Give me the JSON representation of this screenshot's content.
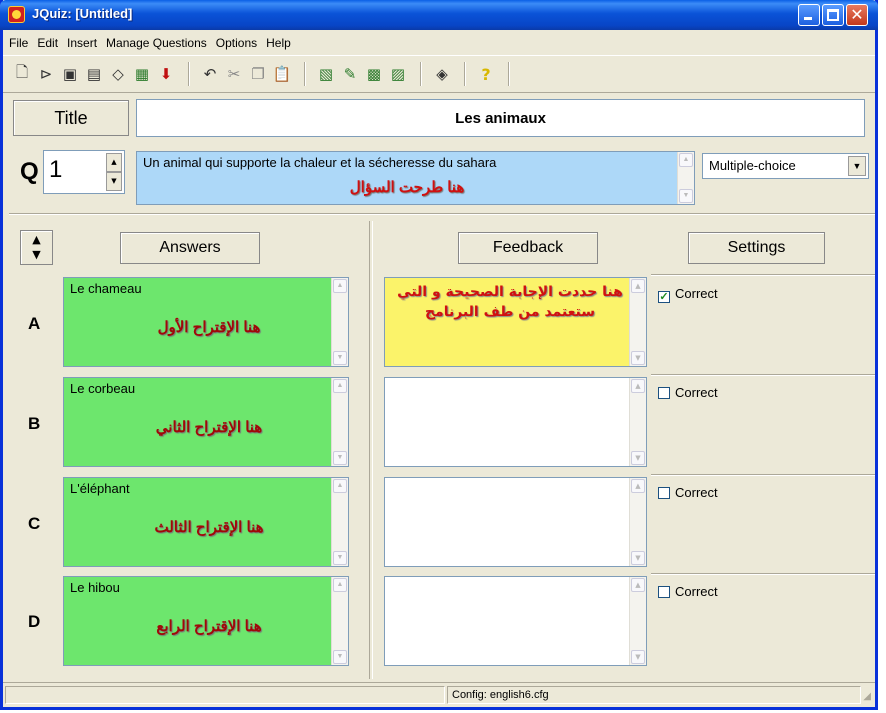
{
  "window": {
    "title": "JQuiz: [Untitled]"
  },
  "menu": [
    "File",
    "Edit",
    "Insert",
    "Manage Questions",
    "Options",
    "Help"
  ],
  "toolbar": {
    "groups": [
      [
        "new-icon",
        "open-icon",
        "save-icon",
        "save-as-icon",
        "clear-icon",
        "html-export-icon",
        "import-icon"
      ],
      [
        "undo-icon",
        "cut-icon",
        "copy-icon",
        "paste-icon"
      ],
      [
        "config-icon",
        "edit-icon",
        "toggle-icon",
        "view-icon"
      ],
      [
        "help-topics-icon"
      ],
      [
        "help-icon"
      ]
    ]
  },
  "title_label": "Title",
  "title_value": "Les animaux",
  "question": {
    "label": "Q",
    "number": "1",
    "text": "Un animal qui supporte la chaleur et la sécheresse du sahara",
    "annotation": "هنا طرحت السؤال",
    "type": "Multiple-choice"
  },
  "columns": {
    "answers": "Answers",
    "feedback": "Feedback",
    "settings": "Settings"
  },
  "rows": [
    {
      "letter": "A",
      "answer": "Le chameau",
      "annotation": "هنا الإقتراح الأول",
      "feedback_annotation": "هنا حددت الإجابة الصحيحة و التي ستعتمد من طف البرنامج",
      "correct_label": "Correct",
      "correct": true
    },
    {
      "letter": "B",
      "answer": "Le corbeau",
      "annotation": "هنا الإقتراح الثاني",
      "feedback_annotation": "",
      "correct_label": "Correct",
      "correct": false
    },
    {
      "letter": "C",
      "answer": "L'éléphant",
      "annotation": "هنا الإقتراح الثالث",
      "feedback_annotation": "",
      "correct_label": "Correct",
      "correct": false
    },
    {
      "letter": "D",
      "answer": "Le hibou",
      "annotation": "هنا الإقتراح الرابع",
      "feedback_annotation": "",
      "correct_label": "Correct",
      "correct": false
    }
  ],
  "status": {
    "config": "Config: english6.cfg"
  },
  "colors": {
    "answer_bg": "#6de66d",
    "question_bg": "#add8f8",
    "feedback_correct_bg": "#fbf36a",
    "annotation": "#d01010"
  }
}
